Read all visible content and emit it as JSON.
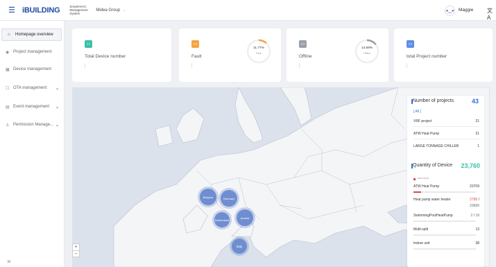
{
  "header": {
    "logo": "iBUILDING",
    "system_name": "SmartHVAC Management System",
    "group": "Midea Group",
    "user": "Maggie"
  },
  "sidebar": {
    "items": [
      {
        "label": "Homepage overview",
        "icon": "home-icon",
        "active": true,
        "expandable": false
      },
      {
        "label": "Project management",
        "icon": "project-icon",
        "active": false,
        "expandable": false
      },
      {
        "label": "Device management",
        "icon": "device-icon",
        "active": false,
        "expandable": false
      },
      {
        "label": "OTA management",
        "icon": "ota-icon",
        "active": false,
        "expandable": true
      },
      {
        "label": "Event management",
        "icon": "event-icon",
        "active": false,
        "expandable": true
      },
      {
        "label": "Permission Manage...",
        "icon": "permission-icon",
        "active": false,
        "expandable": true
      }
    ]
  },
  "cards": [
    {
      "title": "Total Device number",
      "color": "#3dbfa8",
      "icon": "device-icon"
    },
    {
      "title": "Fault",
      "color": "#f4a340",
      "icon": "fault-icon",
      "percent": "11.77%",
      "sub": "Fault",
      "ring_color": "#f4a340",
      "ring_fraction": 0.1177
    },
    {
      "title": "Offline",
      "color": "#9aa0a8",
      "icon": "offline-icon",
      "percent": "14.59%",
      "sub": "Offline",
      "ring_color": "#9aa0a8",
      "ring_fraction": 0.1459
    },
    {
      "title": "total Project number",
      "color": "#5b8ee6",
      "icon": "project-icon"
    }
  ],
  "map": {
    "clusters": [
      {
        "label": "Belgium"
      },
      {
        "label": "Germany"
      },
      {
        "label": "Switzerland"
      },
      {
        "label": "Austria"
      },
      {
        "label": "Italy"
      }
    ],
    "zoom_in": "+",
    "zoom_out": "−"
  },
  "panel": {
    "projects_title": "Number of projects",
    "projects_total": "43",
    "all_label": "[ All ]",
    "project_rows": [
      {
        "name": "VRF project",
        "value": "21"
      },
      {
        "name": "ATW Heat Pump",
        "value": "21"
      },
      {
        "name": "LARGE TONNAGE CHILLER",
        "value": "1"
      }
    ],
    "devices_title": "Quantity of Device",
    "devices_total": "23,760",
    "fault_legend": "fault count",
    "device_rows": [
      {
        "name": "ATW Heat Pump",
        "fault": "",
        "value": "23709",
        "fault_fraction": 0.12
      },
      {
        "name": "Heat pump water heater",
        "fault": "2795",
        "value": "23690",
        "fault_fraction": 0.0
      },
      {
        "name": "SwimmingPoolHeatPump",
        "fault": "2",
        "value": "19",
        "fault_fraction": 0.0
      },
      {
        "name": "Multi-split",
        "fault": "",
        "value": "13",
        "fault_fraction": 0.0
      },
      {
        "name": "Indoor unit",
        "fault": "",
        "value": "38",
        "fault_fraction": 0.0
      }
    ],
    "accent_color": "#2f6fd8",
    "projects_total_color": "#2f6fd8",
    "devices_total_color": "#3dbfa8"
  }
}
